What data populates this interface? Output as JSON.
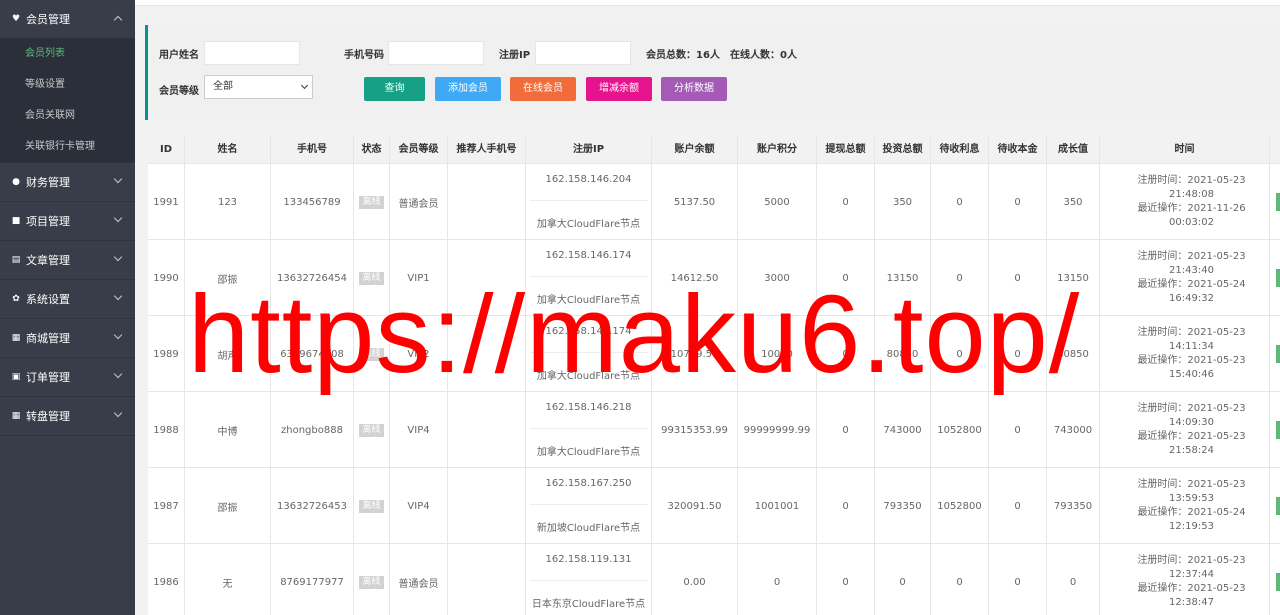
{
  "sidebar": {
    "groups": [
      {
        "label": "会员管理",
        "icon": "member-icon",
        "expanded": true,
        "items": [
          {
            "label": "会员列表",
            "active": true
          },
          {
            "label": "等级设置",
            "active": false
          },
          {
            "label": "会员关联网",
            "active": false
          },
          {
            "label": "关联银行卡管理",
            "active": false
          }
        ]
      },
      {
        "label": "财务管理",
        "icon": "finance-icon",
        "expanded": false
      },
      {
        "label": "项目管理",
        "icon": "project-icon",
        "expanded": false
      },
      {
        "label": "文章管理",
        "icon": "article-icon",
        "expanded": false
      },
      {
        "label": "系统设置",
        "icon": "gear-icon",
        "expanded": false
      },
      {
        "label": "商城管理",
        "icon": "shop-icon",
        "expanded": false
      },
      {
        "label": "订单管理",
        "icon": "order-icon",
        "expanded": false
      },
      {
        "label": "转盘管理",
        "icon": "wheel-icon",
        "expanded": false
      }
    ]
  },
  "filter": {
    "username_label": "用户姓名",
    "phone_label": "手机号码",
    "ip_label": "注册IP",
    "total_members": "会员总数：16人",
    "online_members": "在线人数：0人",
    "level_label": "会员等级",
    "level_value": "全部",
    "buttons": {
      "search": "查询",
      "add_member": "添加会员",
      "online_member": "在线会员",
      "adjust_balance": "增减余额",
      "analyze": "分析数据"
    },
    "colors": {
      "search": "#16a085",
      "add_member": "#3fa9f5",
      "online_member": "#f26b3a",
      "adjust_balance": "#e5148c",
      "analyze": "#a55bb5"
    }
  },
  "table": {
    "headers": [
      "ID",
      "姓名",
      "手机号",
      "状态",
      "会员等级",
      "推荐人手机号",
      "注册IP",
      "账户余额",
      "账户积分",
      "提现总额",
      "投资总额",
      "待收利息",
      "待收本金",
      "成长值",
      "时间"
    ],
    "rows": [
      {
        "id": "1991",
        "name": "123",
        "phone": "133456789",
        "status": "离线",
        "level": "普通会员",
        "referrer": "",
        "ip": "162.158.146.204",
        "ip_loc": "加拿大CloudFlare节点",
        "balance": "5137.50",
        "points": "5000",
        "withdraw": "0",
        "invest": "350",
        "interest": "0",
        "principal": "0",
        "growth": "350",
        "reg_time": "注册时间：2021-05-23 21:48:08",
        "last_op": "最近操作：2021-11-26 00:03:02"
      },
      {
        "id": "1990",
        "name": "邵振",
        "phone": "13632726454",
        "status": "离线",
        "level": "VIP1",
        "referrer": "",
        "ip": "162.158.146.174",
        "ip_loc": "加拿大CloudFlare节点",
        "balance": "14612.50",
        "points": "3000",
        "withdraw": "0",
        "invest": "13150",
        "interest": "0",
        "principal": "0",
        "growth": "13150",
        "reg_time": "注册时间：2021-05-23 21:43:40",
        "last_op": "最近操作：2021-05-24 16:49:32"
      },
      {
        "id": "1989",
        "name": "胡声",
        "phone": "6399674408",
        "status": "离线",
        "level": "VIP2",
        "referrer": "",
        "ip": "162.158.146.174",
        "ip_loc": "加拿大CloudFlare节点",
        "balance": "10749.50",
        "points": "10000",
        "withdraw": "0",
        "invest": "80850",
        "interest": "0",
        "principal": "0",
        "growth": "80850",
        "reg_time": "注册时间：2021-05-23 14:11:34",
        "last_op": "最近操作：2021-05-23 15:40:46"
      },
      {
        "id": "1988",
        "name": "中博",
        "phone": "zhongbo888",
        "status": "离线",
        "level": "VIP4",
        "referrer": "",
        "ip": "162.158.146.218",
        "ip_loc": "加拿大CloudFlare节点",
        "balance": "99315353.99",
        "points": "99999999.99",
        "withdraw": "0",
        "invest": "743000",
        "interest": "1052800",
        "principal": "0",
        "growth": "743000",
        "reg_time": "注册时间：2021-05-23 14:09:30",
        "last_op": "最近操作：2021-05-23 21:58:24"
      },
      {
        "id": "1987",
        "name": "邵振",
        "phone": "13632726453",
        "status": "离线",
        "level": "VIP4",
        "referrer": "",
        "ip": "162.158.167.250",
        "ip_loc": "新加坡CloudFlare节点",
        "balance": "320091.50",
        "points": "1001001",
        "withdraw": "0",
        "invest": "793350",
        "interest": "1052800",
        "principal": "0",
        "growth": "793350",
        "reg_time": "注册时间：2021-05-23 13:59:53",
        "last_op": "最近操作：2021-05-24 12:19:53"
      },
      {
        "id": "1986",
        "name": "无",
        "phone": "8769177977",
        "status": "离线",
        "level": "普通会员",
        "referrer": "",
        "ip": "162.158.119.131",
        "ip_loc": "日本东京CloudFlare节点",
        "balance": "0.00",
        "points": "0",
        "withdraw": "0",
        "invest": "0",
        "interest": "0",
        "principal": "0",
        "growth": "0",
        "reg_time": "注册时间：2021-05-23 12:37:44",
        "last_op": "最近操作：2021-05-23 12:38:47"
      }
    ]
  },
  "watermark": "https://maku6.top/"
}
